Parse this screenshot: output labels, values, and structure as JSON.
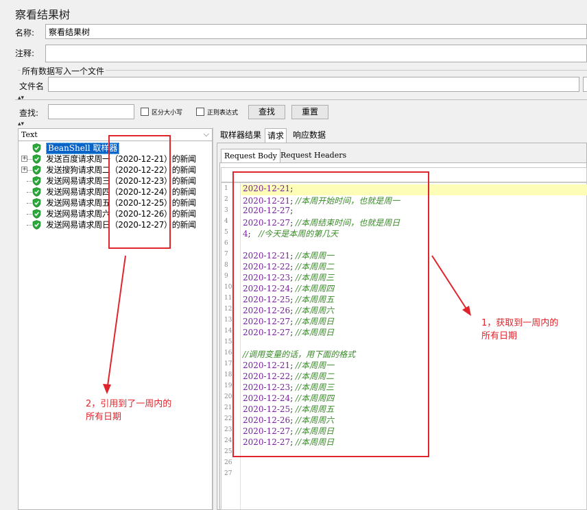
{
  "panel_title": "察看结果树",
  "name_label": "名称:",
  "name_value": "察看结果树",
  "comment_label": "注释:",
  "file_group_title": "所有数据写入一个文件",
  "filename_label": "文件名",
  "search": {
    "label": "查找:",
    "case_label": "区分大小写",
    "regex_label": "正则表达式",
    "find_button": "查找",
    "reset_button": "重置"
  },
  "renderer_select": "Text",
  "tree": {
    "root": "BeanShell 取样器",
    "items": [
      {
        "label": "发送百度请求周一（2020-12-21）的新闻",
        "expandable": true
      },
      {
        "label": "发送搜狗请求周二（2020-12-22）的新闻",
        "expandable": true
      },
      {
        "label": "发送网易请求周三（2020-12-23）的新闻",
        "expandable": false
      },
      {
        "label": "发送网易请求周四（2020-12-24）的新闻",
        "expandable": false
      },
      {
        "label": "发送网易请求周五（2020-12-25）的新闻",
        "expandable": false
      },
      {
        "label": "发送网易请求周六（2020-12-26）的新闻",
        "expandable": false
      },
      {
        "label": "发送网易请求周日（2020-12-27）的新闻",
        "expandable": false
      }
    ]
  },
  "tabs": [
    "取样器结果",
    "请求",
    "响应数据"
  ],
  "subtabs": [
    "Request Body",
    "Request Headers"
  ],
  "code_lines": [
    [
      {
        "t": "2020-12-21",
        "c": "date"
      },
      {
        "t": ";",
        "c": "num"
      }
    ],
    [
      {
        "t": "2020-12-21",
        "c": "date"
      },
      {
        "t": "; ",
        "c": "num"
      },
      {
        "t": "//本周开始时间，也就是周一",
        "c": "cmt"
      }
    ],
    [
      {
        "t": "2020-12-27",
        "c": "date"
      },
      {
        "t": ";",
        "c": "num"
      }
    ],
    [
      {
        "t": "2020-12-27",
        "c": "date"
      },
      {
        "t": "; ",
        "c": "num"
      },
      {
        "t": "//本周结束时间，也就是周日",
        "c": "cmt"
      }
    ],
    [
      {
        "t": "4",
        "c": "date"
      },
      {
        "t": ";   ",
        "c": "num"
      },
      {
        "t": "//今天是本周的第几天",
        "c": "cmt"
      }
    ],
    [],
    [
      {
        "t": "2020-12-21",
        "c": "date"
      },
      {
        "t": "; ",
        "c": "num"
      },
      {
        "t": "//本周周一",
        "c": "cmt"
      }
    ],
    [
      {
        "t": "2020-12-22",
        "c": "date"
      },
      {
        "t": "; ",
        "c": "num"
      },
      {
        "t": "//本周周二",
        "c": "cmt"
      }
    ],
    [
      {
        "t": "2020-12-23",
        "c": "date"
      },
      {
        "t": "; ",
        "c": "num"
      },
      {
        "t": "//本周周三",
        "c": "cmt"
      }
    ],
    [
      {
        "t": "2020-12-24",
        "c": "date"
      },
      {
        "t": "; ",
        "c": "num"
      },
      {
        "t": "//本周周四",
        "c": "cmt"
      }
    ],
    [
      {
        "t": "2020-12-25",
        "c": "date"
      },
      {
        "t": "; ",
        "c": "num"
      },
      {
        "t": "//本周周五",
        "c": "cmt"
      }
    ],
    [
      {
        "t": "2020-12-26",
        "c": "date"
      },
      {
        "t": "; ",
        "c": "num"
      },
      {
        "t": "//本周周六",
        "c": "cmt"
      }
    ],
    [
      {
        "t": "2020-12-27",
        "c": "date"
      },
      {
        "t": "; ",
        "c": "num"
      },
      {
        "t": "//本周周日",
        "c": "cmt"
      }
    ],
    [
      {
        "t": "2020-12-27",
        "c": "date"
      },
      {
        "t": "; ",
        "c": "num"
      },
      {
        "t": "//本周周日",
        "c": "cmt"
      }
    ],
    [],
    [
      {
        "t": "//调用变量的话，用下面的格式",
        "c": "cmt"
      }
    ],
    [
      {
        "t": "2020-12-21",
        "c": "date"
      },
      {
        "t": "; ",
        "c": "num"
      },
      {
        "t": "//本周周一",
        "c": "cmt"
      }
    ],
    [
      {
        "t": "2020-12-22",
        "c": "date"
      },
      {
        "t": "; ",
        "c": "num"
      },
      {
        "t": "//本周周二",
        "c": "cmt"
      }
    ],
    [
      {
        "t": "2020-12-23",
        "c": "date"
      },
      {
        "t": "; ",
        "c": "num"
      },
      {
        "t": "//本周周三",
        "c": "cmt"
      }
    ],
    [
      {
        "t": "2020-12-24",
        "c": "date"
      },
      {
        "t": "; ",
        "c": "num"
      },
      {
        "t": "//本周周四",
        "c": "cmt"
      }
    ],
    [
      {
        "t": "2020-12-25",
        "c": "date"
      },
      {
        "t": "; ",
        "c": "num"
      },
      {
        "t": "//本周周五",
        "c": "cmt"
      }
    ],
    [
      {
        "t": "2020-12-26",
        "c": "date"
      },
      {
        "t": "; ",
        "c": "num"
      },
      {
        "t": "//本周周六",
        "c": "cmt"
      }
    ],
    [
      {
        "t": "2020-12-27",
        "c": "date"
      },
      {
        "t": "; ",
        "c": "num"
      },
      {
        "t": "//本周周日",
        "c": "cmt"
      }
    ],
    [
      {
        "t": "2020-12-27",
        "c": "date"
      },
      {
        "t": "; ",
        "c": "num"
      },
      {
        "t": "//本周周日",
        "c": "cmt"
      }
    ],
    [],
    [],
    []
  ],
  "annotations": {
    "right_line1": "1，获取到一周内的",
    "right_line2": "所有日期",
    "left_line1": "2，引用到了一周内的",
    "left_line2": "所有日期"
  },
  "colors": {
    "annotation": "#e0242c",
    "date": "#7a1fa2",
    "comment": "#3a8a2a",
    "highlight_line": "#fdfdb8",
    "tree_selection": "#0a64c8",
    "shield": "#2aa83a"
  }
}
